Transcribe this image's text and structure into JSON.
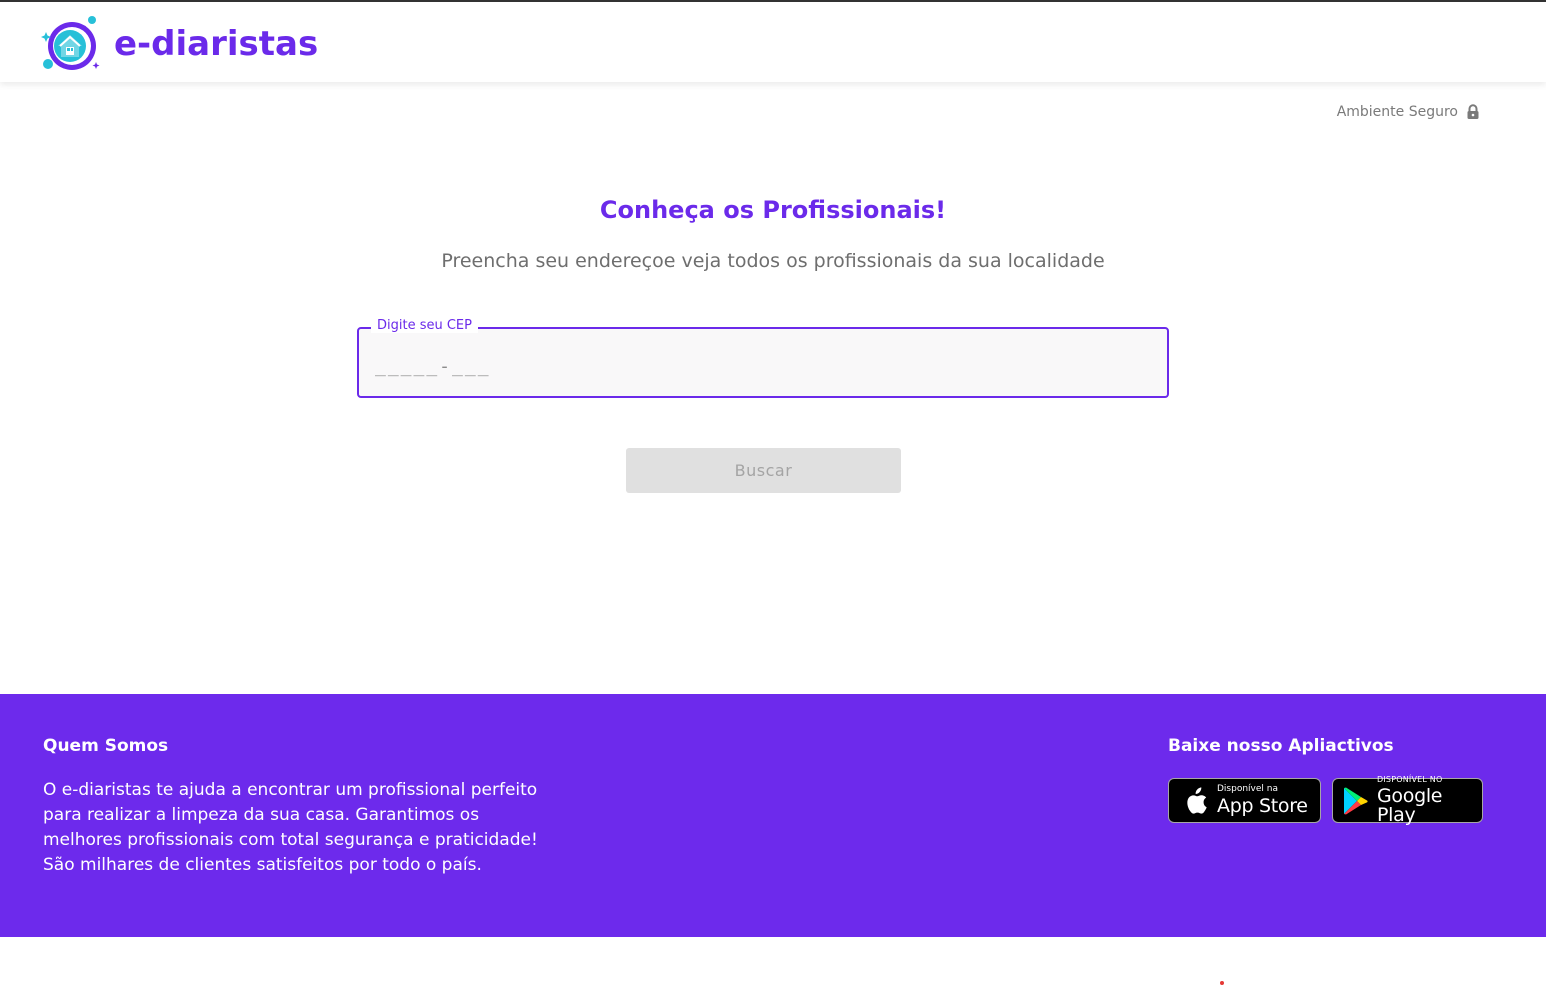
{
  "header": {
    "brand_name": "e-diaristas",
    "logo_icon": "house-cleaning-logo-icon"
  },
  "secure": {
    "label": "Ambiente Seguro",
    "icon": "lock-icon"
  },
  "main": {
    "title": "Conheça os Profissionais!",
    "subtitle": "Preencha seu endereçoe veja todos os profissionais da sua localidade",
    "cep_field": {
      "label": "Digite seu CEP",
      "placeholder": "_____-___",
      "value": ""
    },
    "search_button": "Buscar"
  },
  "footer": {
    "about_title": "Quem Somos",
    "about_text": "O e-diaristas te ajuda a encontrar um profissional perfeito para realizar a limpeza da sua casa. Garantimos os melhores profissionais com total segurança e praticidade! São milhares de clientes satisfeitos por todo o país.",
    "apps_title": "Baixe nosso Apliactivos",
    "app_store": {
      "small": "Disponível na",
      "big": "App Store",
      "icon": "apple-icon"
    },
    "google_play": {
      "small": "DISPONÍVEL NO",
      "big": "Google Play",
      "icon": "google-play-icon"
    }
  },
  "colors": {
    "brand_purple": "#6b2aea",
    "footer_purple": "#6d2aec",
    "button_disabled_bg": "#e0e0e0",
    "text_gray": "#6e6e6e"
  }
}
